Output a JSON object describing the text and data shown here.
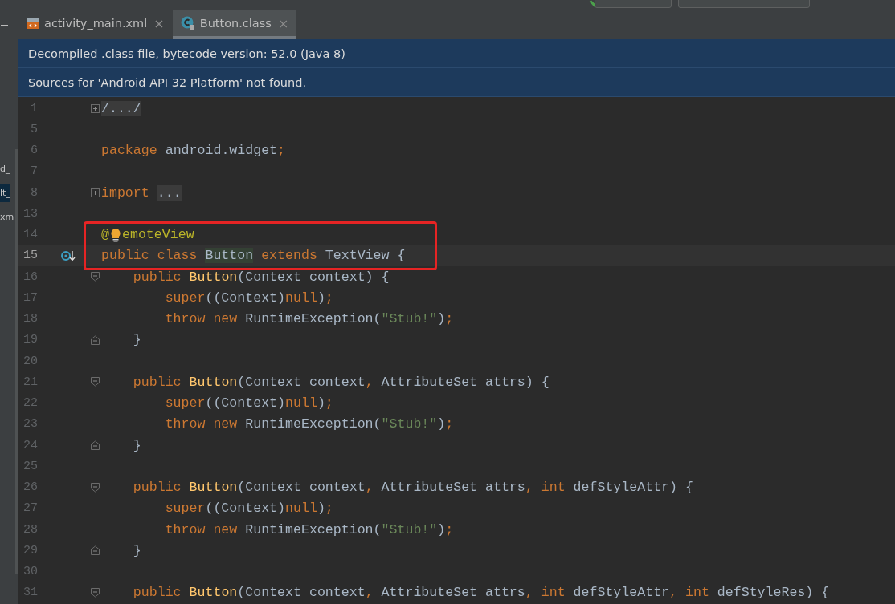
{
  "side_panel": {
    "fragments": [
      "d_",
      "lt_",
      "xm"
    ]
  },
  "tabs": [
    {
      "label": "activity_main.xml",
      "kind": "xml",
      "selected": false,
      "close": "×"
    },
    {
      "label": "Button.class",
      "kind": "class",
      "selected": true,
      "close": "×"
    }
  ],
  "banners": [
    "Decompiled .class file, bytecode version: 52.0 (Java 8)",
    "Sources for 'Android API 32 Platform' not found."
  ],
  "lines": [
    {
      "number": "1",
      "current": false,
      "kind": "expand",
      "tokens": [
        {
          "kind": "folded",
          "text": "/.../"
        }
      ]
    },
    {
      "number": "5",
      "current": false,
      "kind": "plain"
    },
    {
      "number": "6",
      "current": false,
      "kind": "plain",
      "tokens": [
        {
          "kind": "kw",
          "text": "package "
        },
        {
          "kind": "plain",
          "text": "android.widget"
        },
        {
          "kind": "kw",
          "text": ";"
        }
      ]
    },
    {
      "number": "7",
      "current": false,
      "kind": "plain"
    },
    {
      "number": "8",
      "current": false,
      "kind": "expand",
      "tokens": [
        {
          "kind": "kw",
          "text": "import "
        },
        {
          "kind": "folded",
          "text": "..."
        }
      ]
    },
    {
      "number": "13",
      "current": false,
      "kind": "plain"
    },
    {
      "number": "14",
      "current": false,
      "kind": "plain",
      "tokens": [
        {
          "kind": "ann",
          "text": "@"
        },
        {
          "kind": "bulb"
        },
        {
          "kind": "ann",
          "text": "emoteView"
        }
      ]
    },
    {
      "number": "15",
      "current": true,
      "kind": "plain",
      "gutter_icon": true,
      "tokens": [
        {
          "kind": "kw",
          "text": "public class "
        },
        {
          "kind": "match",
          "text": "Button"
        },
        {
          "kind": "kw",
          "text": " extends "
        },
        {
          "kind": "plain",
          "text": "TextView {"
        }
      ]
    },
    {
      "number": "16",
      "current": false,
      "kind": "fold-open",
      "tokens": [
        {
          "kind": "kw",
          "text": "    public "
        },
        {
          "kind": "fn",
          "text": "Button"
        },
        {
          "kind": "plain",
          "text": "(Context context) {"
        }
      ]
    },
    {
      "number": "17",
      "current": false,
      "kind": "plain",
      "tokens": [
        {
          "kind": "kw",
          "text": "        super"
        },
        {
          "kind": "plain",
          "text": "((Context)"
        },
        {
          "kind": "kw",
          "text": "null"
        },
        {
          "kind": "plain",
          "text": ")"
        },
        {
          "kind": "kw",
          "text": ";"
        }
      ]
    },
    {
      "number": "18",
      "current": false,
      "kind": "plain",
      "tokens": [
        {
          "kind": "kw",
          "text": "        throw new "
        },
        {
          "kind": "plain",
          "text": "RuntimeException("
        },
        {
          "kind": "str",
          "text": "\"Stub!\""
        },
        {
          "kind": "plain",
          "text": ")"
        },
        {
          "kind": "kw",
          "text": ";"
        }
      ]
    },
    {
      "number": "19",
      "current": false,
      "kind": "fold-close",
      "tokens": [
        {
          "kind": "plain",
          "text": "    }"
        }
      ]
    },
    {
      "number": "20",
      "current": false,
      "kind": "plain"
    },
    {
      "number": "21",
      "current": false,
      "kind": "fold-open",
      "tokens": [
        {
          "kind": "kw",
          "text": "    public "
        },
        {
          "kind": "fn",
          "text": "Button"
        },
        {
          "kind": "plain",
          "text": "(Context context"
        },
        {
          "kind": "kw",
          "text": ", "
        },
        {
          "kind": "plain",
          "text": "AttributeSet attrs) {"
        }
      ]
    },
    {
      "number": "22",
      "current": false,
      "kind": "plain",
      "tokens": [
        {
          "kind": "kw",
          "text": "        super"
        },
        {
          "kind": "plain",
          "text": "((Context)"
        },
        {
          "kind": "kw",
          "text": "null"
        },
        {
          "kind": "plain",
          "text": ")"
        },
        {
          "kind": "kw",
          "text": ";"
        }
      ]
    },
    {
      "number": "23",
      "current": false,
      "kind": "plain",
      "tokens": [
        {
          "kind": "kw",
          "text": "        throw new "
        },
        {
          "kind": "plain",
          "text": "RuntimeException("
        },
        {
          "kind": "str",
          "text": "\"Stub!\""
        },
        {
          "kind": "plain",
          "text": ")"
        },
        {
          "kind": "kw",
          "text": ";"
        }
      ]
    },
    {
      "number": "24",
      "current": false,
      "kind": "fold-close",
      "tokens": [
        {
          "kind": "plain",
          "text": "    }"
        }
      ]
    },
    {
      "number": "25",
      "current": false,
      "kind": "plain"
    },
    {
      "number": "26",
      "current": false,
      "kind": "fold-open",
      "tokens": [
        {
          "kind": "kw",
          "text": "    public "
        },
        {
          "kind": "fn",
          "text": "Button"
        },
        {
          "kind": "plain",
          "text": "(Context context"
        },
        {
          "kind": "kw",
          "text": ", "
        },
        {
          "kind": "plain",
          "text": "AttributeSet attrs"
        },
        {
          "kind": "kw",
          "text": ", int "
        },
        {
          "kind": "plain",
          "text": "defStyleAttr) {"
        }
      ]
    },
    {
      "number": "27",
      "current": false,
      "kind": "plain",
      "tokens": [
        {
          "kind": "kw",
          "text": "        super"
        },
        {
          "kind": "plain",
          "text": "((Context)"
        },
        {
          "kind": "kw",
          "text": "null"
        },
        {
          "kind": "plain",
          "text": ")"
        },
        {
          "kind": "kw",
          "text": ";"
        }
      ]
    },
    {
      "number": "28",
      "current": false,
      "kind": "plain",
      "tokens": [
        {
          "kind": "kw",
          "text": "        throw new "
        },
        {
          "kind": "plain",
          "text": "RuntimeException("
        },
        {
          "kind": "str",
          "text": "\"Stub!\""
        },
        {
          "kind": "plain",
          "text": ")"
        },
        {
          "kind": "kw",
          "text": ";"
        }
      ]
    },
    {
      "number": "29",
      "current": false,
      "kind": "fold-close",
      "tokens": [
        {
          "kind": "plain",
          "text": "    }"
        }
      ]
    },
    {
      "number": "30",
      "current": false,
      "kind": "plain"
    },
    {
      "number": "31",
      "current": false,
      "kind": "fold-open",
      "tokens": [
        {
          "kind": "kw",
          "text": "    public "
        },
        {
          "kind": "fn",
          "text": "Button"
        },
        {
          "kind": "plain",
          "text": "(Context context"
        },
        {
          "kind": "kw",
          "text": ", "
        },
        {
          "kind": "plain",
          "text": "AttributeSet attrs"
        },
        {
          "kind": "kw",
          "text": ", int "
        },
        {
          "kind": "plain",
          "text": "defStyleAttr"
        },
        {
          "kind": "kw",
          "text": ", int "
        },
        {
          "kind": "plain",
          "text": "defStyleRes) {"
        }
      ]
    }
  ]
}
